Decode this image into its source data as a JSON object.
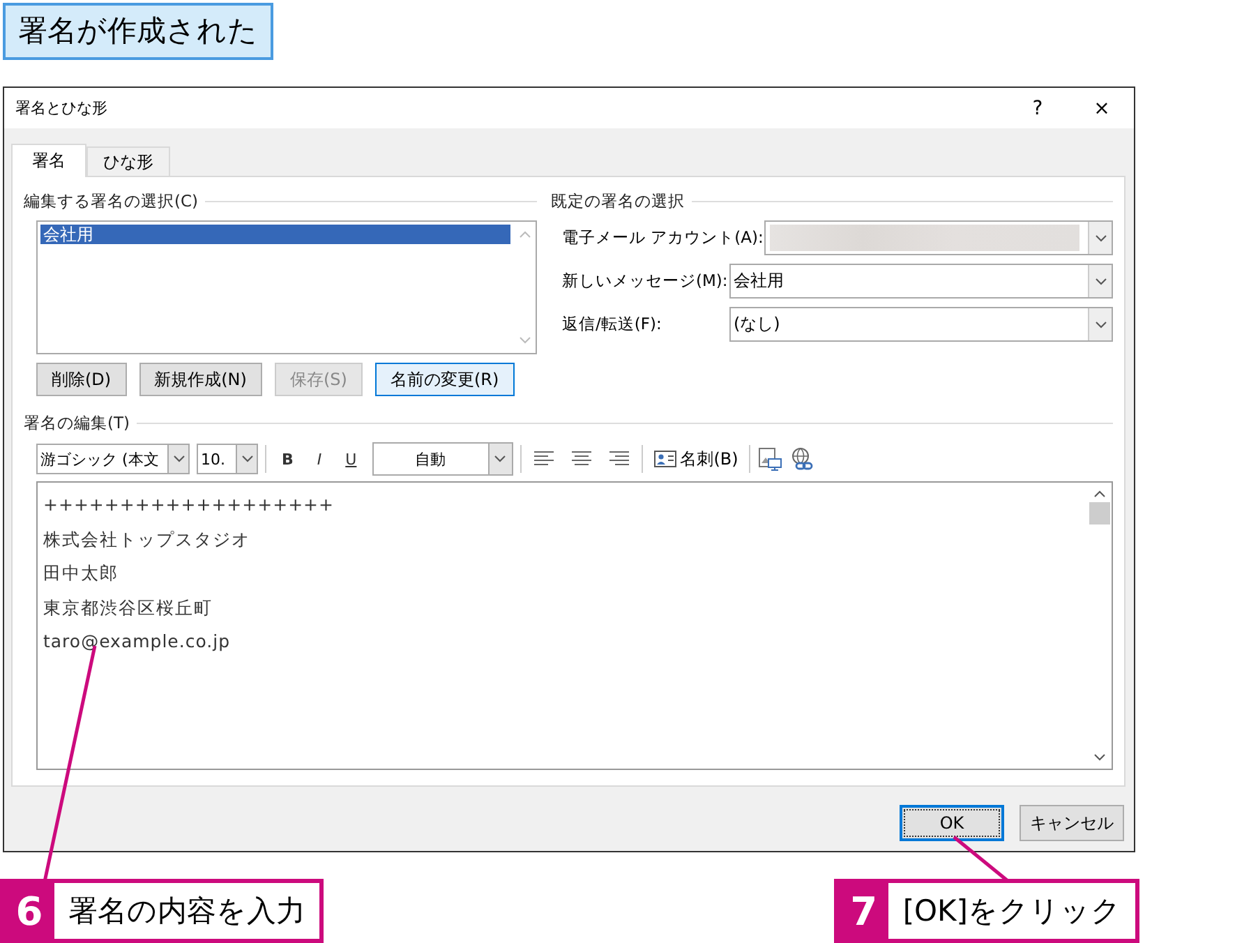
{
  "heading": "署名が作成された",
  "window": {
    "title": "署名とひな形",
    "help": "?",
    "close": "×"
  },
  "tabs": [
    {
      "label": "署名",
      "selected": true
    },
    {
      "label": "ひな形",
      "selected": false
    }
  ],
  "select_signature": {
    "label": "編集する署名の選択(C)",
    "items": [
      {
        "label": "会社用",
        "selected": true
      }
    ]
  },
  "signature_buttons": [
    {
      "label": "削除(D)",
      "disabled": false,
      "focused": false
    },
    {
      "label": "新規作成(N)",
      "disabled": false,
      "focused": false
    },
    {
      "label": "保存(S)",
      "disabled": true,
      "focused": false
    },
    {
      "label": "名前の変更(R)",
      "disabled": false,
      "focused": true
    }
  ],
  "default_signature": {
    "label": "既定の署名の選択",
    "fields": [
      {
        "label": "電子メール アカウント(A):",
        "kind": "blurred"
      },
      {
        "label": "新しいメッセージ(M):",
        "kind": "select",
        "value": "会社用"
      },
      {
        "label": "返信/転送(F):",
        "kind": "select",
        "value": "(なし)"
      }
    ]
  },
  "edit_signature": {
    "label": "署名の編集(T)",
    "toolbar": {
      "font": "游ゴシック (本文",
      "size": "10.",
      "bold": "B",
      "italic": "I",
      "underline": "U",
      "text_color": "自動",
      "business_card": "名刺(B)"
    },
    "lines": [
      "+++++++++++++++++++",
      "株式会社トップスタジオ",
      "田中太郎",
      "東京都渋谷区桜丘町",
      "taro@example.co.jp"
    ]
  },
  "footer_buttons": [
    {
      "label": "OK",
      "default": true
    },
    {
      "label": "キャンセル",
      "default": false
    }
  ],
  "callouts": [
    {
      "number": "6",
      "text": "署名の内容を入力"
    },
    {
      "number": "7",
      "text": "[OK]をクリック"
    }
  ]
}
